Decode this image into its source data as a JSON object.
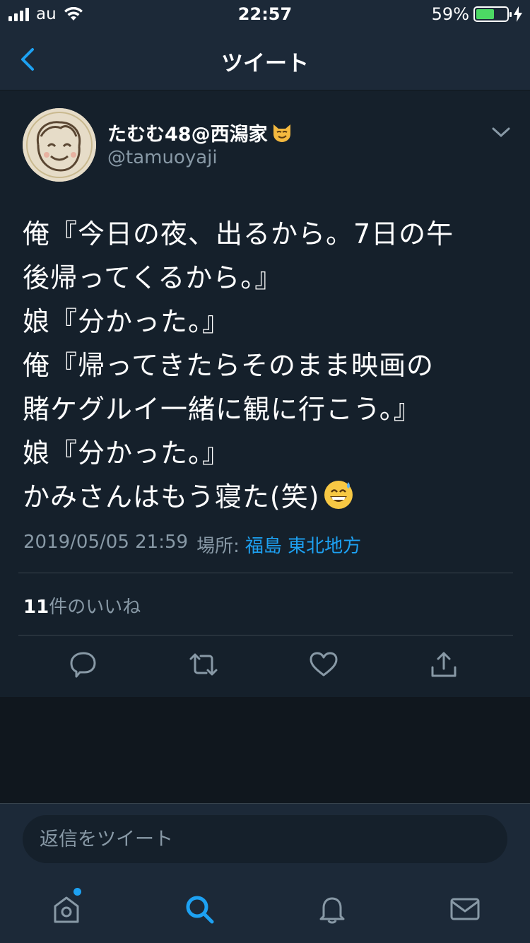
{
  "status_bar": {
    "carrier": "au",
    "time": "22:57",
    "battery_percent": "59%",
    "battery_level": 0.59,
    "battery_color": "#4cd964"
  },
  "nav": {
    "title": "ツイート",
    "back_icon": "chevron-left-icon"
  },
  "tweet": {
    "display_name": "たむむ48@西潟家",
    "name_emoji_icon": "smirking-cat-icon",
    "handle": "@tamuoyaji",
    "text_lines": [
      "俺『今日の夜、出るから。7日の午",
      "後帰ってくるから。』",
      "娘『分かった。』",
      "俺『帰ってきたらそのまま映画の",
      "賭ケグルイ一緒に観に行こう。』",
      "娘『分かった。』",
      "かみさんはもう寝た(笑)"
    ],
    "end_emoji_icon": "grinning-sweat-icon",
    "timestamp": "2019/05/05 21:59",
    "location_label": "場所:",
    "location": "福島 東北地方",
    "likes_count": "11",
    "likes_label": "件のいいね"
  },
  "actions": [
    "reply-icon",
    "retweet-icon",
    "like-icon",
    "share-icon"
  ],
  "reply": {
    "placeholder": "返信をツイート"
  },
  "tabs": [
    "home-icon",
    "search-icon",
    "notifications-icon",
    "messages-icon"
  ],
  "colors": {
    "background": "#15202b",
    "bar": "#1c2938",
    "accent": "#1da1f2",
    "secondary_text": "#8899a6"
  }
}
